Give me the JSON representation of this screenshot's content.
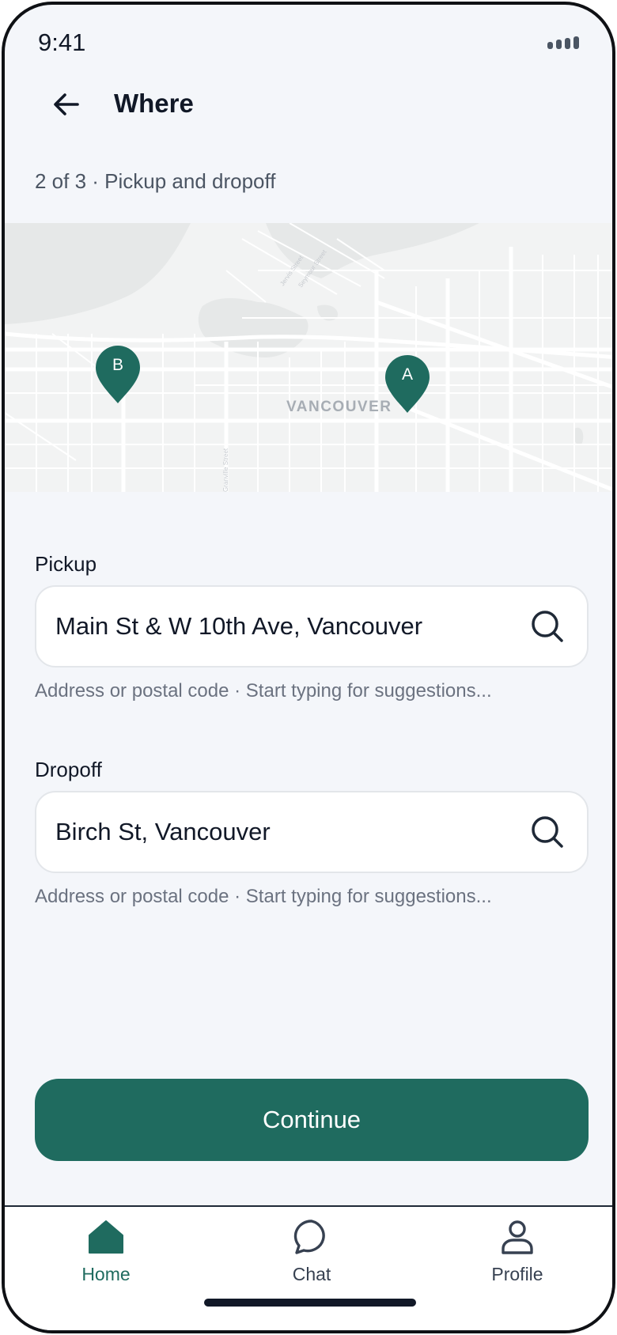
{
  "status_bar": {
    "time": "9:41"
  },
  "header": {
    "title": "Where",
    "back_icon": "arrow-left-icon"
  },
  "step": {
    "text": "2 of 3 · Pickup and dropoff"
  },
  "map": {
    "city_label": "VANCOUVER",
    "pins": [
      {
        "label": "A",
        "color": "#1f6b5f"
      },
      {
        "label": "B",
        "color": "#1f6b5f"
      }
    ]
  },
  "pickup": {
    "label": "Pickup",
    "value": "Main St & W 10th Ave, Vancouver",
    "hint": "Address or postal code · Start typing for suggestions...",
    "icon": "search-icon"
  },
  "dropoff": {
    "label": "Dropoff",
    "value": "Birch St, Vancouver",
    "hint": "Address or postal code · Start typing for suggestions...",
    "icon": "search-icon"
  },
  "continue_label": "Continue",
  "nav": {
    "items": [
      {
        "label": "Home",
        "icon": "home-icon",
        "active": true
      },
      {
        "label": "Chat",
        "icon": "chat-bubble-icon",
        "active": false
      },
      {
        "label": "Profile",
        "icon": "person-icon",
        "active": false
      }
    ]
  },
  "colors": {
    "accent": "#1f6b5f",
    "background": "#f4f6fa",
    "text": "#111827",
    "muted": "#6b7280"
  }
}
